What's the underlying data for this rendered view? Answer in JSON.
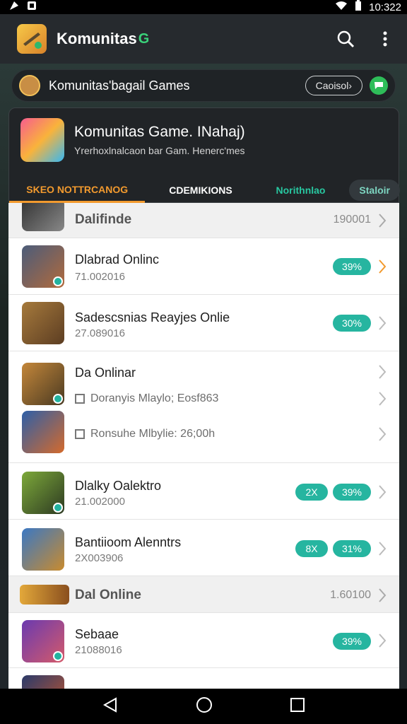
{
  "status": {
    "time": "10:322"
  },
  "appbar": {
    "title": "Komunitas",
    "badge": "G"
  },
  "community": {
    "label": "Komunitas'bagail Games",
    "button": "Caoisol›"
  },
  "game": {
    "title": "Komunitas Game. INahaj)",
    "subtitle": "Yrerhoxlnalcaon bar Gam. Henerc'mes"
  },
  "tabs": [
    "SKEO NOTTRCANOG",
    "CDEMIKIONS",
    "Norithnlao",
    "Staloir"
  ],
  "colors": {
    "accent": "#f29a2e",
    "teal": "#26b5a0"
  },
  "list": {
    "section1": {
      "title": "Dalifinde",
      "count": "190001"
    },
    "items": [
      {
        "title": "Dlabrad Onlinc",
        "sub": "71.002016",
        "badge": "39%"
      },
      {
        "title": "Sadescsnias Reayjes Onlie",
        "sub": "27.089016",
        "badge": "30%"
      },
      {
        "title": "Da Onlinar",
        "sub": ""
      },
      {
        "title": "Dlalky Oalektro",
        "sub": "21.002000",
        "badge_small": "2X",
        "badge": "39%"
      },
      {
        "title": "Bantiioom Alenntrs",
        "sub": "2X003906",
        "badge_small": "8X",
        "badge": "31%"
      },
      {
        "title": "Sebaae",
        "sub": "21088016",
        "badge": "39%"
      }
    ],
    "checks": [
      "Doranyis Mlaylo; Eosf863",
      "Ronsuhe Mlbylie: 26;00h"
    ],
    "section2": {
      "title": "Dal Online",
      "count": "1.60100"
    }
  }
}
